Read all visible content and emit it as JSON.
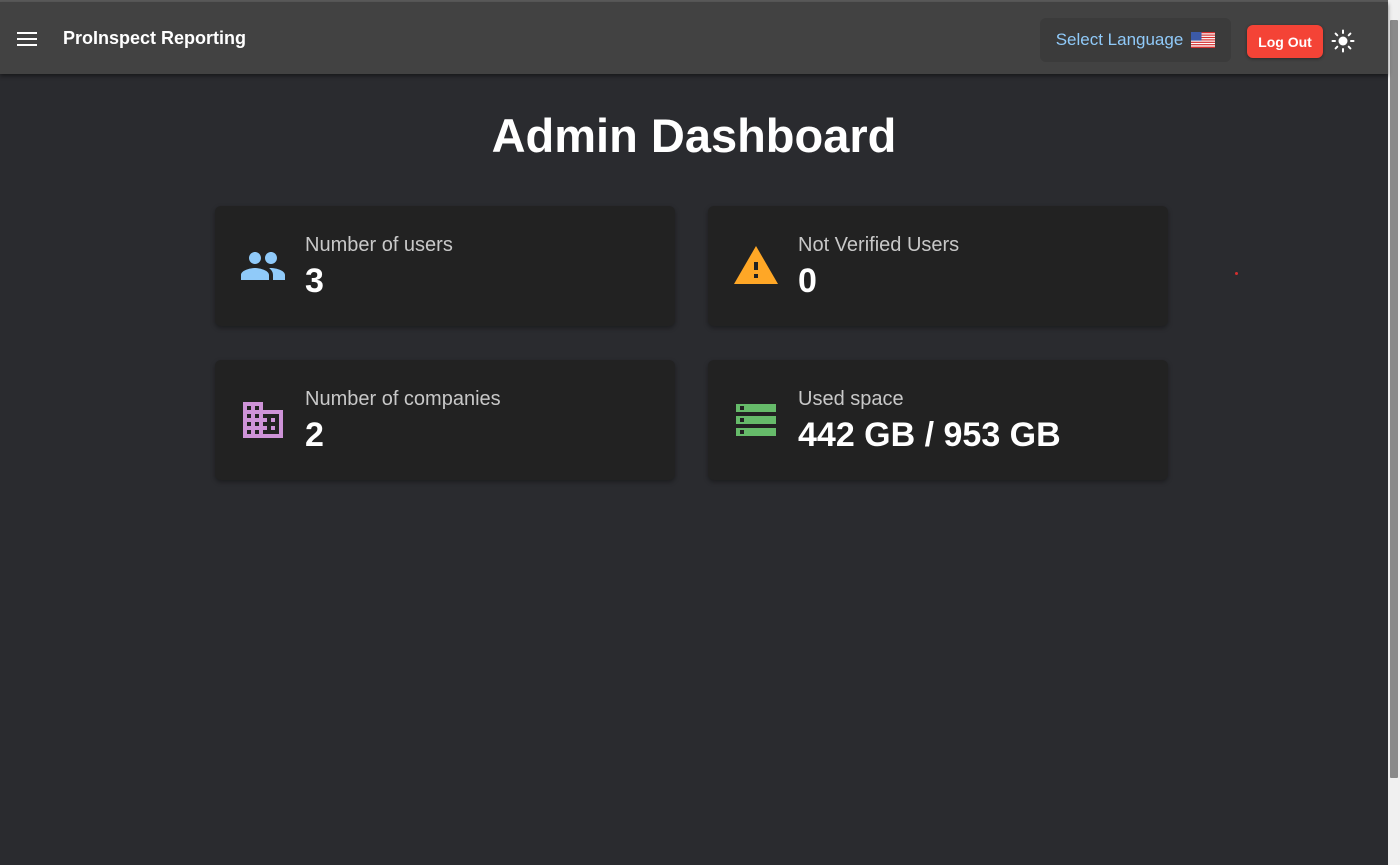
{
  "header": {
    "app_title": "ProInspect Reporting",
    "language_label": "Select Language",
    "logout_label": "Log Out"
  },
  "main": {
    "title": "Admin Dashboard",
    "cards": [
      {
        "label": "Number of users",
        "value": "3",
        "icon": "users-icon",
        "color": "#90caf9"
      },
      {
        "label": "Not Verified Users",
        "value": "0",
        "icon": "warning-icon",
        "color": "#ffa726"
      },
      {
        "label": "Number of companies",
        "value": "2",
        "icon": "building-icon",
        "color": "#ce93d8"
      },
      {
        "label": "Used space",
        "value": "442 GB / 953 GB",
        "icon": "storage-icon",
        "color": "#66bb6a"
      }
    ]
  },
  "colors": {
    "accent": "#90caf9",
    "danger": "#f44336",
    "background": "#2a2b2f",
    "appbar": "#424242",
    "card": "#222222"
  }
}
